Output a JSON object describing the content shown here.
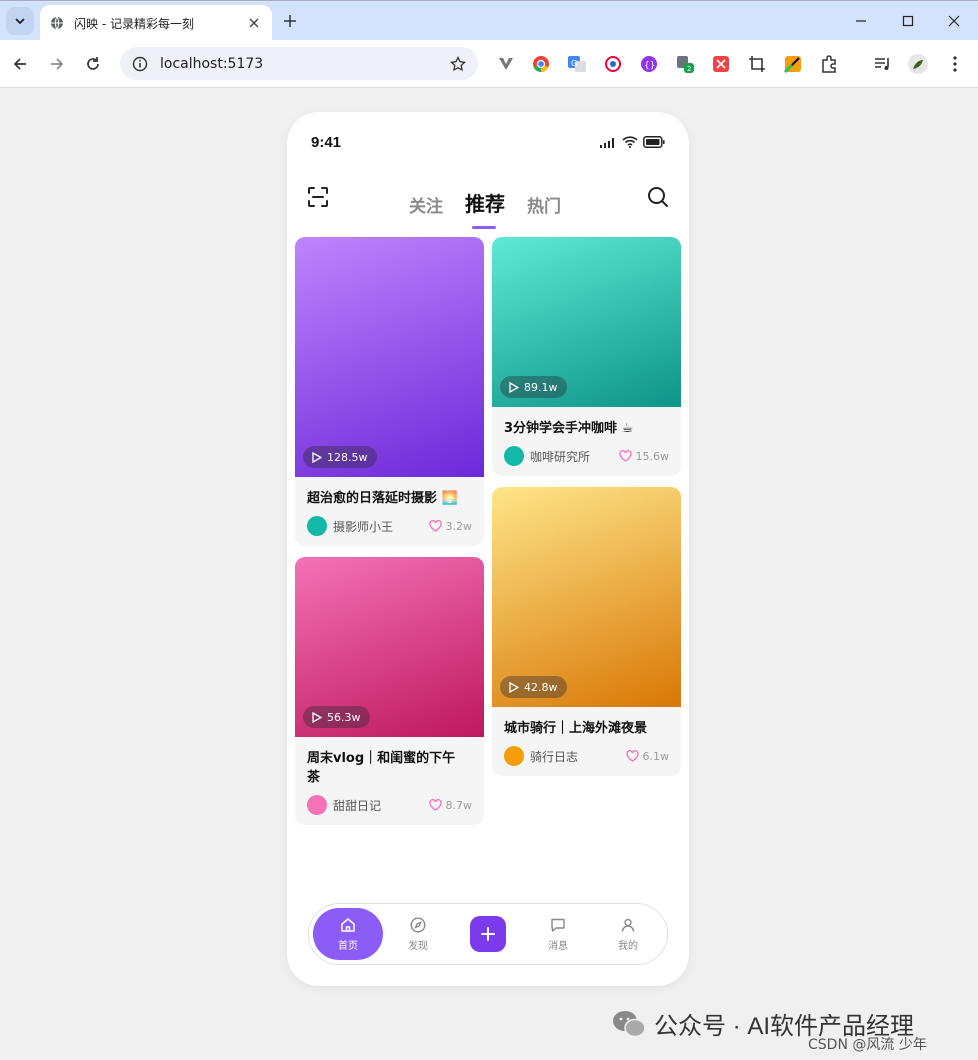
{
  "browser": {
    "tab_title": "闪映 - 记录精彩每一刻",
    "url": "localhost:5173"
  },
  "status_bar": {
    "time": "9:41"
  },
  "header": {
    "tabs": [
      {
        "label": "关注",
        "active": false
      },
      {
        "label": "推荐",
        "active": true
      },
      {
        "label": "热门",
        "active": false
      }
    ]
  },
  "feed": [
    {
      "title": "超治愈的日落延时摄影 🌅",
      "views": "128.5w",
      "author": "摄影师小王",
      "likes": "3.2w",
      "gradient": [
        "#c084fc",
        "#6d28d9"
      ],
      "avatar_color": "#14b8a6"
    },
    {
      "title": "3分钟学会手冲咖啡 ☕",
      "views": "89.1w",
      "author": "咖啡研究所",
      "likes": "15.6w",
      "gradient": [
        "#5eead4",
        "#0d9488"
      ],
      "avatar_color": "#14b8a6"
    },
    {
      "title": "周末vlog｜和闺蜜的下午茶",
      "views": "56.3w",
      "author": "甜甜日记",
      "likes": "8.7w",
      "gradient": [
        "#f472b6",
        "#be185d"
      ],
      "avatar_color": "#f472b6"
    },
    {
      "title": "城市骑行｜上海外滩夜景",
      "views": "42.8w",
      "author": "骑行日志",
      "likes": "6.1w",
      "gradient": [
        "#fde68a",
        "#d97706"
      ],
      "avatar_color": "#f59e0b"
    }
  ],
  "bottom_nav": {
    "items": [
      {
        "label": "首页",
        "icon": "home-icon",
        "active": true
      },
      {
        "label": "发现",
        "icon": "compass-icon",
        "active": false
      },
      {
        "label": "消息",
        "icon": "message-icon",
        "active": false
      },
      {
        "label": "我的",
        "icon": "user-icon",
        "active": false
      }
    ]
  },
  "watermark": {
    "brand": "公众号 · AI软件产品经理",
    "csdn": "CSDN @风流 少年"
  },
  "colors": {
    "accent": "#8b5cf6",
    "like": "#f472b6"
  }
}
